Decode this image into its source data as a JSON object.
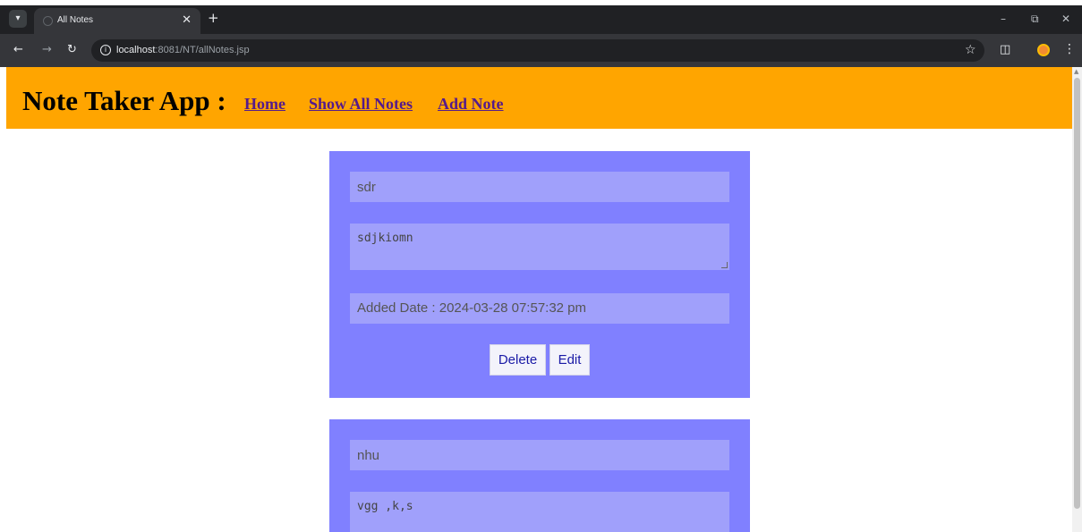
{
  "browser": {
    "tab_title": "All Notes",
    "url_host": "localhost",
    "url_path": ":8081/NT/allNotes.jsp",
    "icons": {
      "tab_menu": "chevron-down-icon",
      "tab_close": "close-icon",
      "new_tab": "plus-icon",
      "back": "back-arrow-icon",
      "forward": "forward-arrow-icon",
      "reload": "reload-icon",
      "site_info": "info-icon",
      "bookmark": "star-icon",
      "extensions": "puzzle-icon",
      "profile": "profile-icon",
      "menu": "kebab-menu-icon"
    }
  },
  "header": {
    "title": "Note Taker App :",
    "nav": [
      "Home",
      "Show All Notes",
      "Add Note"
    ],
    "background": "#ffa500",
    "link_color": "#551a8b"
  },
  "notes": [
    {
      "title": "sdr",
      "content": "sdjkiomn",
      "date": "Added Date : 2024-03-28 07:57:32 pm",
      "delete_label": "Delete",
      "edit_label": "Edit"
    },
    {
      "title": "nhu",
      "content": "vgg ,k,s"
    }
  ],
  "colors": {
    "card": "#8080ff",
    "field": "#a0a0fb"
  }
}
